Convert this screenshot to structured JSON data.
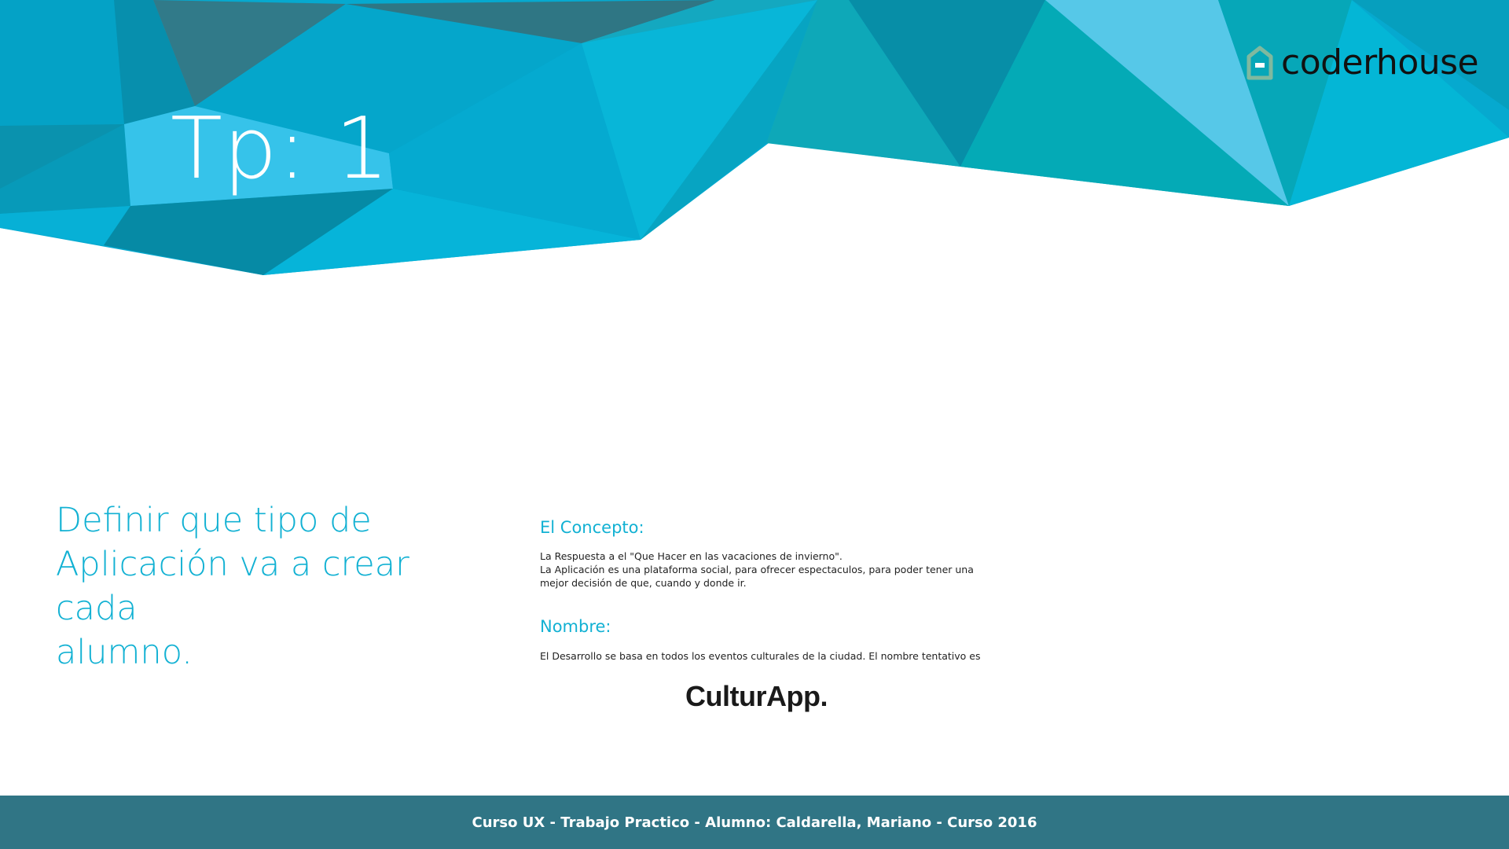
{
  "slide": {
    "title": "Tp: 1",
    "logo_text": "coderhouse",
    "heading_lines": [
      "Definir que tipo de",
      "Aplicación va a crear cada",
      "alumno."
    ]
  },
  "concept": {
    "label": "El Concepto:",
    "lines": [
      "La Respuesta a el \"Que Hacer en las vacaciones de invierno\".",
      "La Aplicación es una plataforma social, para ofrecer espectaculos, para poder tener una",
      "mejor decisión de que, cuando y donde ir."
    ]
  },
  "name_section": {
    "label": "Nombre:",
    "line": "El Desarrollo se basa en todos los eventos culturales de la ciudad. El nombre tentativo es",
    "app_name": "CulturApp."
  },
  "footer": {
    "text": "Curso UX - Trabajo Practico - Alumno: Caldarella, Mariano - Curso 2016"
  },
  "colors": {
    "accent": "#12b1d3",
    "footer_bg": "#307585",
    "logo_mark": "#7fb99f"
  },
  "icons": {
    "logo": "house-outline-icon"
  }
}
